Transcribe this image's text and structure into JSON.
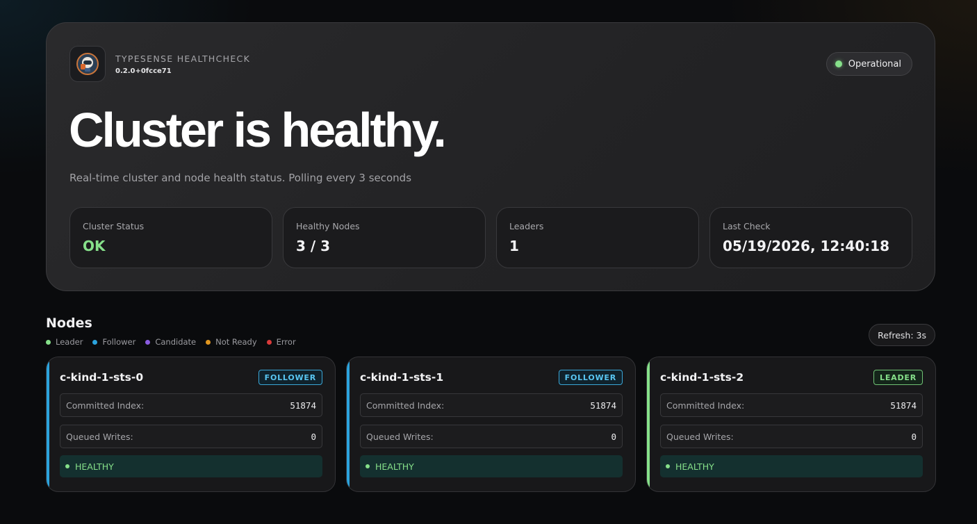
{
  "brand": {
    "name": "TYPESENSE HEALTHCHECK",
    "version": "0.2.0+0fcce71"
  },
  "status_pill": {
    "label": "Operational",
    "color": "#86e08a"
  },
  "headline": "Cluster is healthy.",
  "subtitle": "Real-time cluster and node health status. Polling every 3 seconds",
  "stats": [
    {
      "label": "Cluster Status",
      "value": "OK"
    },
    {
      "label": "Healthy Nodes",
      "value": "3 / 3"
    },
    {
      "label": "Leaders",
      "value": "1"
    },
    {
      "label": "Last Check",
      "value": "05/19/2026, 12:40:18"
    }
  ],
  "nodes_section": {
    "title": "Nodes",
    "refresh_label": "Refresh: 3s",
    "legend": [
      {
        "label": "Leader",
        "color": "#86e08a"
      },
      {
        "label": "Follower",
        "color": "#2ba3dd"
      },
      {
        "label": "Candidate",
        "color": "#8a5ce0"
      },
      {
        "label": "Not Ready",
        "color": "#e0961f"
      },
      {
        "label": "Error",
        "color": "#d93a3a"
      }
    ]
  },
  "row_labels": {
    "committed": "Committed Index:",
    "queued": "Queued Writes:"
  },
  "nodes": [
    {
      "name": "c-kind-1-sts-0",
      "role": "FOLLOWER",
      "accent": "#2ba3dd",
      "committed_index": "51874",
      "queued_writes": "0",
      "health": "HEALTHY"
    },
    {
      "name": "c-kind-1-sts-1",
      "role": "FOLLOWER",
      "accent": "#2ba3dd",
      "committed_index": "51874",
      "queued_writes": "0",
      "health": "HEALTHY"
    },
    {
      "name": "c-kind-1-sts-2",
      "role": "LEADER",
      "accent": "#86e08a",
      "committed_index": "51874",
      "queued_writes": "0",
      "health": "HEALTHY"
    }
  ]
}
